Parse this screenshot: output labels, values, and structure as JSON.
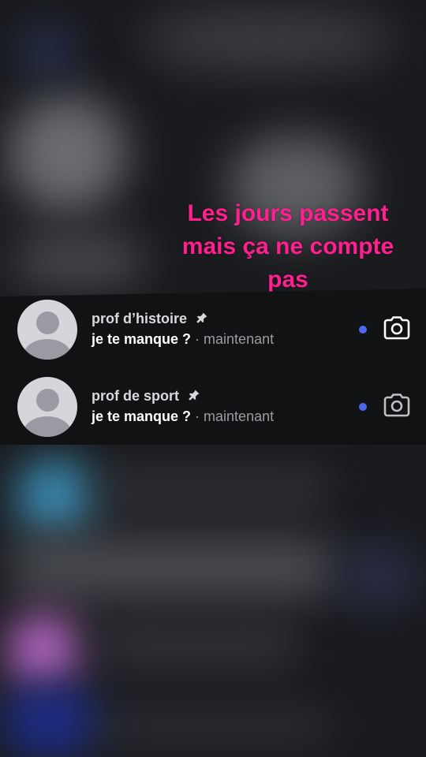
{
  "overlay": {
    "line1": "Les jours passent",
    "line2": "mais ça ne compte",
    "line3": "pas",
    "color": "#ff1f8e"
  },
  "conversations": [
    {
      "name": "prof d’histoire",
      "pinned": true,
      "message": "je te manque ?",
      "time": "· maintenant",
      "unread_dot_color": "#4c67f0",
      "action_icon": "camera-icon"
    },
    {
      "name": "prof de sport",
      "pinned": true,
      "message": "je te manque ?",
      "time": "· maintenant",
      "unread_dot_color": "#4c67f0",
      "action_icon": "camera-icon"
    }
  ]
}
